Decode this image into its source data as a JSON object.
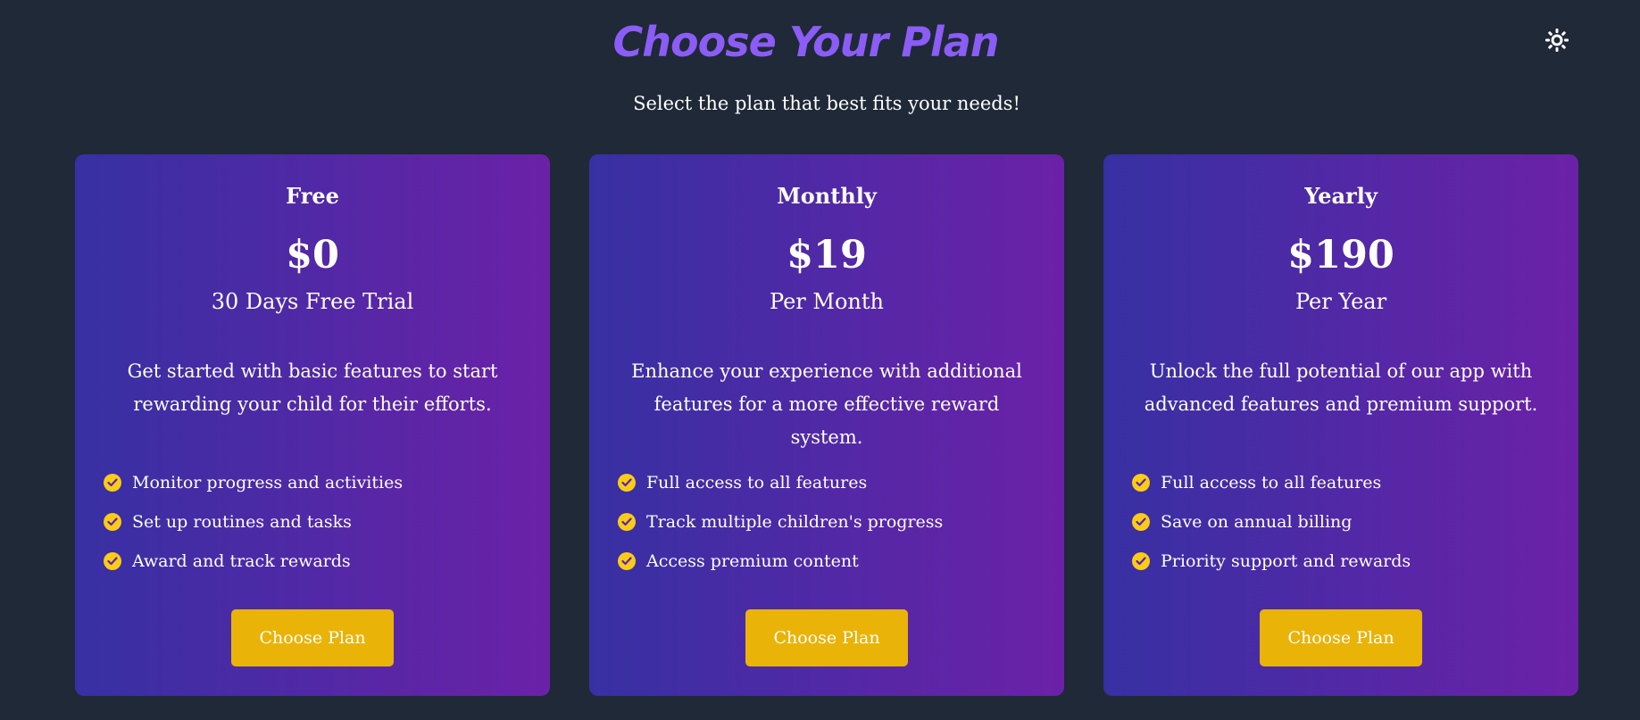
{
  "header": {
    "title": "Choose Your Plan",
    "subtitle": "Select the plan that best fits your needs!",
    "theme_toggle_icon": "sun-icon"
  },
  "colors": {
    "background": "#1f2937",
    "title": "#8b5cf6",
    "card_gradient_start": "#3730a3",
    "card_gradient_end": "#6b21a8",
    "accent": "#eab308",
    "check": "#facc15"
  },
  "plans": [
    {
      "name": "Free",
      "price": "$0",
      "period": "30 Days Free Trial",
      "description": "Get started with basic features to start rewarding your child for their efforts.",
      "features": [
        "Monitor progress and activities",
        "Set up routines and tasks",
        "Award and track rewards"
      ],
      "button_label": "Choose Plan"
    },
    {
      "name": "Monthly",
      "price": "$19",
      "period": "Per Month",
      "description": "Enhance your experience with additional features for a more effective reward system.",
      "features": [
        "Full access to all features",
        "Track multiple children's progress",
        "Access premium content"
      ],
      "button_label": "Choose Plan"
    },
    {
      "name": "Yearly",
      "price": "$190",
      "period": "Per Year",
      "description": "Unlock the full potential of our app with advanced features and premium support.",
      "features": [
        "Full access to all features",
        "Save on annual billing",
        "Priority support and rewards"
      ],
      "button_label": "Choose Plan"
    }
  ],
  "icons": {
    "feature_check": "check-circle-icon"
  }
}
